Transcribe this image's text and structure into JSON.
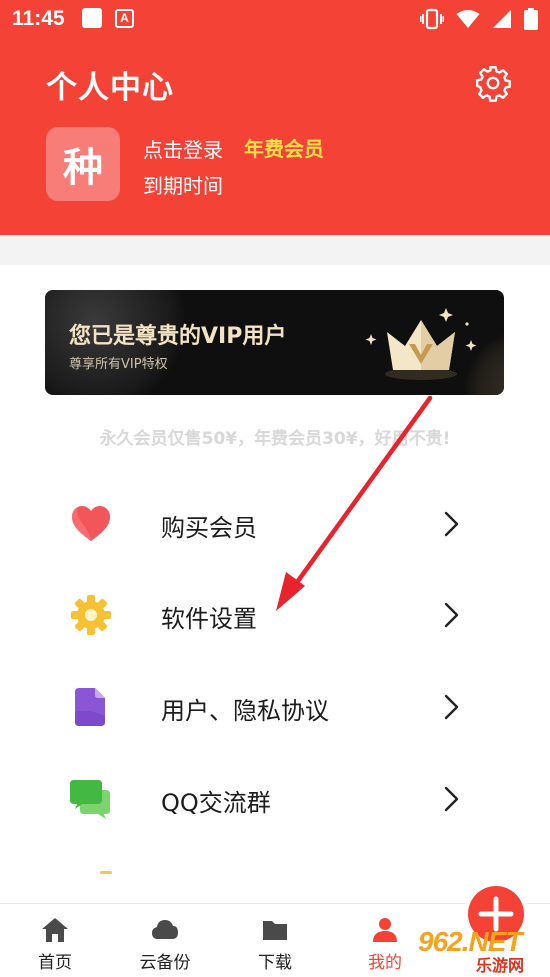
{
  "status_bar": {
    "time": "11:45",
    "notification_letter": "A"
  },
  "header": {
    "title": "个人中心",
    "avatar_char": "种",
    "login_text": "点击登录",
    "member_badge": "年费会员",
    "expire_label": "到期时间"
  },
  "vip_banner": {
    "title": "您已是尊贵的VIP用户",
    "subtitle": "尊享所有VIP特权"
  },
  "promo": "永久会员仅售50¥，年费会员30¥，好用不贵!",
  "menu": [
    {
      "label": "购买会员",
      "icon": "heart-icon"
    },
    {
      "label": "软件设置",
      "icon": "gear-icon"
    },
    {
      "label": "用户、隐私协议",
      "icon": "document-icon"
    },
    {
      "label": "QQ交流群",
      "icon": "chat-icon"
    }
  ],
  "bottom_nav": [
    {
      "label": "首页",
      "icon": "home-icon",
      "active": false
    },
    {
      "label": "云备份",
      "icon": "cloud-icon",
      "active": false
    },
    {
      "label": "下载",
      "icon": "folder-icon",
      "active": false
    },
    {
      "label": "我的",
      "icon": "person-icon",
      "active": true
    }
  ],
  "watermark": {
    "logo": "962.NET",
    "sub": "乐游网"
  },
  "colors": {
    "primary": "#f44336",
    "badge_gold": "#ffe04a",
    "banner_bg": "#0f0f0f",
    "banner_text": "#f3e3c4"
  }
}
